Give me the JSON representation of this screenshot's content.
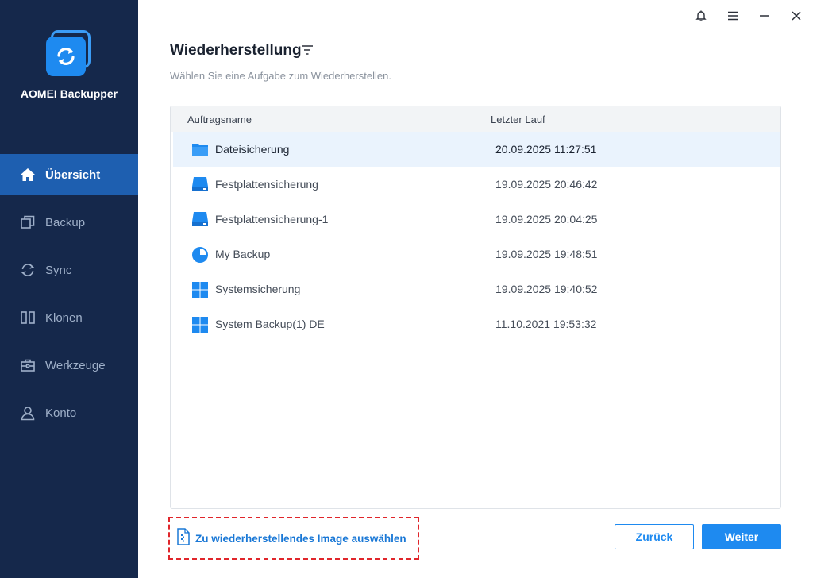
{
  "app": {
    "name": "AOMEI Backupper"
  },
  "sidebar": {
    "items": [
      {
        "label": "Übersicht",
        "icon": "home-icon",
        "active": true
      },
      {
        "label": "Backup",
        "icon": "backup-icon",
        "active": false
      },
      {
        "label": "Sync",
        "icon": "sync-icon",
        "active": false
      },
      {
        "label": "Klonen",
        "icon": "clone-icon",
        "active": false
      },
      {
        "label": "Werkzeuge",
        "icon": "toolbox-icon",
        "active": false
      },
      {
        "label": "Konto",
        "icon": "user-icon",
        "active": false
      }
    ]
  },
  "window": {
    "icons": [
      "bell-icon",
      "menu-icon",
      "minimize-icon",
      "close-icon"
    ]
  },
  "main": {
    "title": "Wiederherstellung",
    "subtitle": "Wählen Sie eine Aufgabe zum Wiederherstellen.",
    "table": {
      "columns": [
        "Auftragsname",
        "Letzter Lauf"
      ],
      "rows": [
        {
          "name": "Dateisicherung",
          "last_run": "20.09.2025 11:27:51",
          "icon": "folder-icon",
          "selected": true
        },
        {
          "name": "Festplattensicherung",
          "last_run": "19.09.2025 20:46:42",
          "icon": "disk-icon",
          "selected": false
        },
        {
          "name": "Festplattensicherung-1",
          "last_run": "19.09.2025 20:04:25",
          "icon": "disk-icon",
          "selected": false
        },
        {
          "name": "My Backup",
          "last_run": "19.09.2025 19:48:51",
          "icon": "partition-icon",
          "selected": false
        },
        {
          "name": "Systemsicherung",
          "last_run": "19.09.2025 19:40:52",
          "icon": "windows-icon",
          "selected": false
        },
        {
          "name": "System Backup(1) DE",
          "last_run": "11.10.2021 19:53:32",
          "icon": "windows-icon",
          "selected": false
        }
      ]
    }
  },
  "footer": {
    "select_image_label": "Zu wiederherstellendes Image auswählen",
    "back_label": "Zurück",
    "next_label": "Weiter"
  },
  "colors": {
    "sidebar_bg": "#15284b",
    "sidebar_active": "#1e5fb0",
    "accent": "#1e8af0",
    "highlight_border": "#e0262b"
  }
}
